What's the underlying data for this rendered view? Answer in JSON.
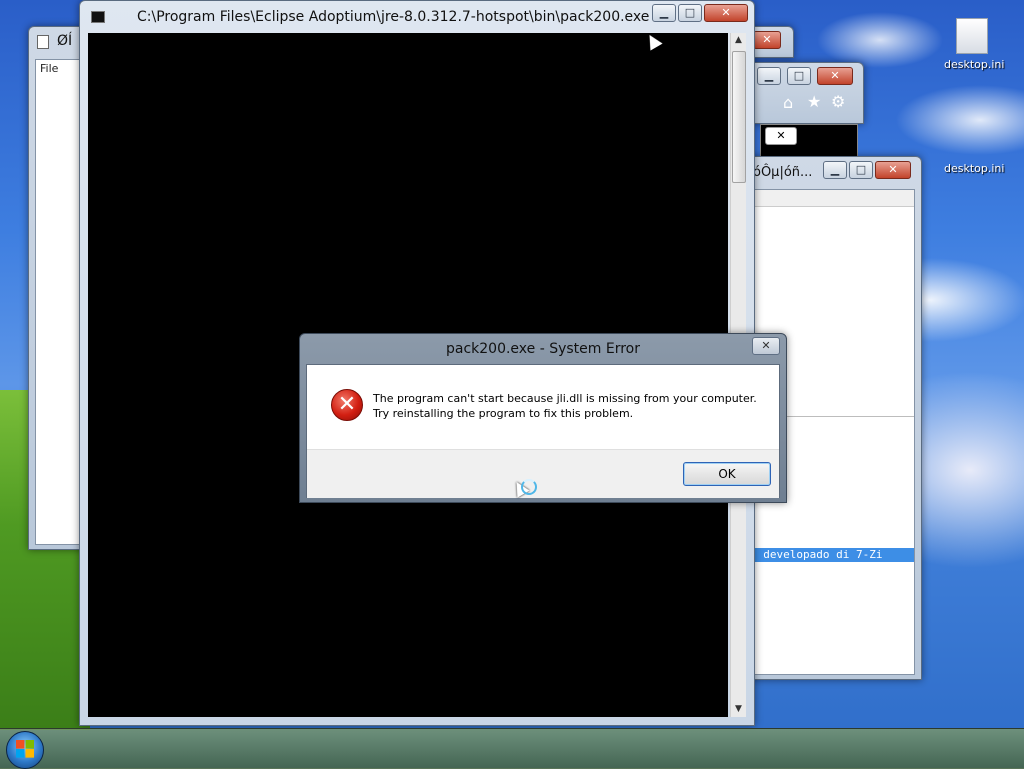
{
  "desktop": {
    "icons": [
      {
        "label": "desktop.ini"
      },
      {
        "label": "desktop.ini"
      }
    ]
  },
  "background_windows": {
    "left_window_title": "ØÍ",
    "left_window_menu": "File",
    "right_window_title": "óÔµ|óñ...",
    "right_window_status_text": "- developado di 7-Zi"
  },
  "console": {
    "title": "C:\\Program Files\\Eclipse Adoptium\\jre-8.0.312.7-hotspot\\bin\\pack200.exe",
    "min_label": "▁",
    "max_label": "□",
    "close_label": "✕"
  },
  "error_dialog": {
    "title": "pack200.exe - System Error",
    "close_label": "✕",
    "icon_glyph": "✕",
    "message_line1": "The program can't start because jli.dll is missing from your computer.",
    "message_line2": "Try reinstalling the program to fix this problem.",
    "ok_label": "OK"
  },
  "icons": {
    "error": "error-icon",
    "start": "windows-start-icon",
    "home": "home-icon",
    "favorites": "star-icon",
    "settings": "gear-icon"
  },
  "colors": {
    "console_bg": "#000000",
    "error_red": "#d21f12",
    "ok_focus": "#2f63b5"
  }
}
